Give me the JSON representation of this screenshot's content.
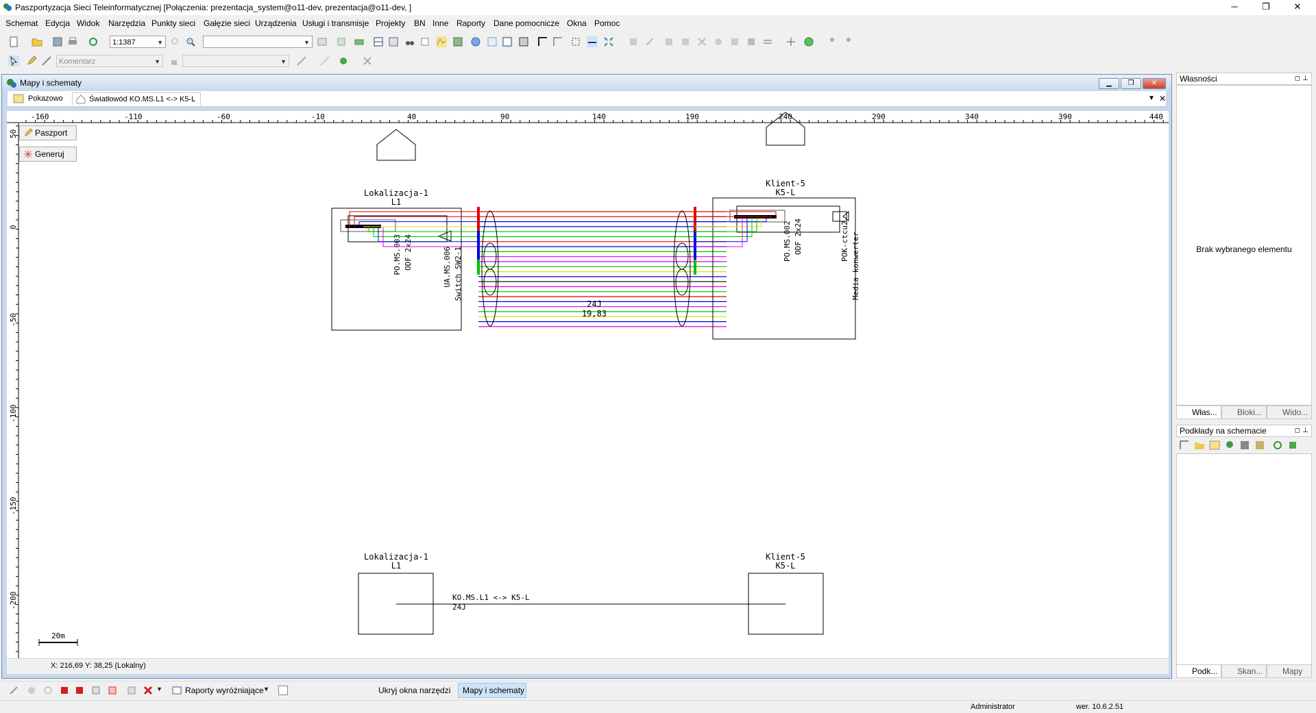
{
  "window": {
    "title": "Paszportyzacja Sieci Teleinformatycznej [Połączenia: prezentacja_system@o11-dev, prezentacja@o11-dev, ]",
    "minimize": "─",
    "restore": "❐",
    "close": "✕"
  },
  "menu": [
    "Schemat",
    "Edycja",
    "Widok",
    "Narzędzia",
    "Punkty sieci",
    "Gałęzie sieci",
    "Urządzenia",
    "Usługi i transmisje",
    "Projekty",
    "BN",
    "Inne",
    "Raporty",
    "Dane pomocnicze",
    "Okna",
    "Pomoc"
  ],
  "toolbar": {
    "scale_value": "1:1387",
    "layer_value": "",
    "comment_placeholder": "Komentarz",
    "second_combo_value": ""
  },
  "mdi": {
    "title": "Mapy i schematy",
    "tabs": [
      {
        "label": "Pokazowo"
      },
      {
        "label": "Światłowód KO.MS.L1 <-> K5-L"
      }
    ],
    "close_tab": "✕",
    "menu_arrow": "▼"
  },
  "ruler": {
    "x_labels": [
      "-160",
      "-110",
      "-60",
      "-10",
      "40",
      "90",
      "140",
      "190",
      "240",
      "290",
      "340",
      "390",
      "440"
    ],
    "y_labels": [
      "50",
      "0",
      "-50",
      "-100",
      "-150",
      "-200"
    ]
  },
  "side_buttons": {
    "passport": "Paszport",
    "generate": "Generuj"
  },
  "schematic": {
    "top_left": {
      "name": "Lokalizacja-1",
      "code": "L1",
      "odf": "PO.MS.003",
      "odf_type": "ODF 2x24",
      "switch": "UA.MS.006",
      "switch_type": "Switch SW2-1"
    },
    "top_right": {
      "name": "Klient-5",
      "code": "K5-L",
      "odf": "PO.MS.002",
      "odf_type": "ODF 2x24",
      "converter": "POK-ctcu2",
      "converter_type": "Media konwerter"
    },
    "cable_fibers": "24J",
    "cable_length": "19,83",
    "bottom_left": {
      "name": "Lokalizacja-1",
      "code": "L1"
    },
    "bottom_right": {
      "name": "Klient-5",
      "code": "K5-L"
    },
    "bottom_cable_name": "KO.MS.L1 <-> K5-L",
    "bottom_cable_fibers": "24J",
    "scale_bar": "20m"
  },
  "coords": "X: 216,69  Y: 38,25 (Lokalny)",
  "right_panel": {
    "properties_title": "Własności",
    "no_selection": "Brak wybranego elementu",
    "tabs_top": [
      "Włas...",
      "Bloki...",
      "Wido..."
    ],
    "layers_title": "Podkłady na schemacie",
    "tabs_bottom": [
      "Podk...",
      "Skan...",
      "Mapy"
    ]
  },
  "bottombar": {
    "reports": "Raporty wyróżniające",
    "hide_tools": "Ukryj okna narzędzi",
    "maps": "Mapy i schematy"
  },
  "statusbar": {
    "user": "Administrator",
    "version": "wer. 10.6.2.51"
  },
  "colors": {
    "accent": "#cce4f7",
    "fiber_red": "#e00000",
    "fiber_blue": "#0000e0",
    "fiber_green": "#00c000",
    "fiber_magenta": "#e000e0",
    "fiber_yellow": "#e0e000"
  }
}
